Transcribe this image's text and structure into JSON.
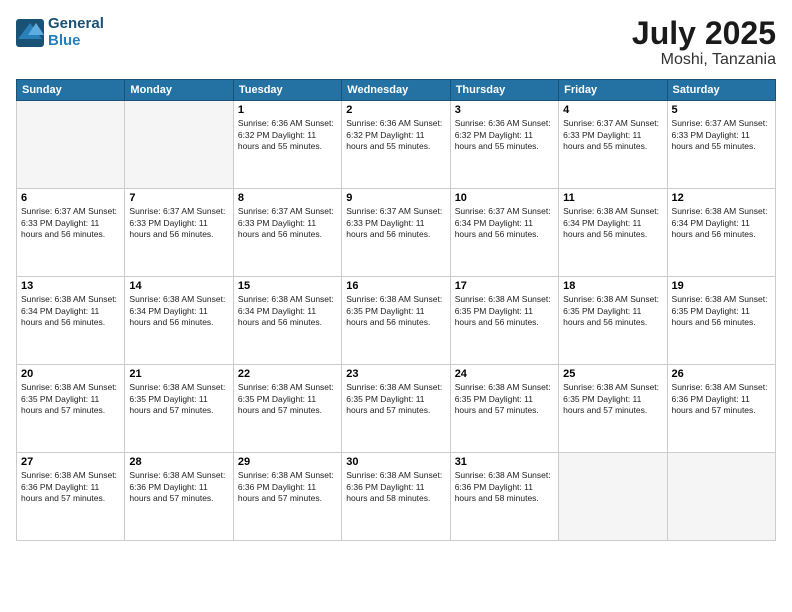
{
  "logo": {
    "line1": "General",
    "line2": "Blue"
  },
  "title": {
    "month_year": "July 2025",
    "location": "Moshi, Tanzania"
  },
  "days_of_week": [
    "Sunday",
    "Monday",
    "Tuesday",
    "Wednesday",
    "Thursday",
    "Friday",
    "Saturday"
  ],
  "weeks": [
    [
      {
        "day": "",
        "info": ""
      },
      {
        "day": "",
        "info": ""
      },
      {
        "day": "1",
        "info": "Sunrise: 6:36 AM\nSunset: 6:32 PM\nDaylight: 11 hours and 55 minutes."
      },
      {
        "day": "2",
        "info": "Sunrise: 6:36 AM\nSunset: 6:32 PM\nDaylight: 11 hours and 55 minutes."
      },
      {
        "day": "3",
        "info": "Sunrise: 6:36 AM\nSunset: 6:32 PM\nDaylight: 11 hours and 55 minutes."
      },
      {
        "day": "4",
        "info": "Sunrise: 6:37 AM\nSunset: 6:33 PM\nDaylight: 11 hours and 55 minutes."
      },
      {
        "day": "5",
        "info": "Sunrise: 6:37 AM\nSunset: 6:33 PM\nDaylight: 11 hours and 55 minutes."
      }
    ],
    [
      {
        "day": "6",
        "info": "Sunrise: 6:37 AM\nSunset: 6:33 PM\nDaylight: 11 hours and 56 minutes."
      },
      {
        "day": "7",
        "info": "Sunrise: 6:37 AM\nSunset: 6:33 PM\nDaylight: 11 hours and 56 minutes."
      },
      {
        "day": "8",
        "info": "Sunrise: 6:37 AM\nSunset: 6:33 PM\nDaylight: 11 hours and 56 minutes."
      },
      {
        "day": "9",
        "info": "Sunrise: 6:37 AM\nSunset: 6:33 PM\nDaylight: 11 hours and 56 minutes."
      },
      {
        "day": "10",
        "info": "Sunrise: 6:37 AM\nSunset: 6:34 PM\nDaylight: 11 hours and 56 minutes."
      },
      {
        "day": "11",
        "info": "Sunrise: 6:38 AM\nSunset: 6:34 PM\nDaylight: 11 hours and 56 minutes."
      },
      {
        "day": "12",
        "info": "Sunrise: 6:38 AM\nSunset: 6:34 PM\nDaylight: 11 hours and 56 minutes."
      }
    ],
    [
      {
        "day": "13",
        "info": "Sunrise: 6:38 AM\nSunset: 6:34 PM\nDaylight: 11 hours and 56 minutes."
      },
      {
        "day": "14",
        "info": "Sunrise: 6:38 AM\nSunset: 6:34 PM\nDaylight: 11 hours and 56 minutes."
      },
      {
        "day": "15",
        "info": "Sunrise: 6:38 AM\nSunset: 6:34 PM\nDaylight: 11 hours and 56 minutes."
      },
      {
        "day": "16",
        "info": "Sunrise: 6:38 AM\nSunset: 6:35 PM\nDaylight: 11 hours and 56 minutes."
      },
      {
        "day": "17",
        "info": "Sunrise: 6:38 AM\nSunset: 6:35 PM\nDaylight: 11 hours and 56 minutes."
      },
      {
        "day": "18",
        "info": "Sunrise: 6:38 AM\nSunset: 6:35 PM\nDaylight: 11 hours and 56 minutes."
      },
      {
        "day": "19",
        "info": "Sunrise: 6:38 AM\nSunset: 6:35 PM\nDaylight: 11 hours and 56 minutes."
      }
    ],
    [
      {
        "day": "20",
        "info": "Sunrise: 6:38 AM\nSunset: 6:35 PM\nDaylight: 11 hours and 57 minutes."
      },
      {
        "day": "21",
        "info": "Sunrise: 6:38 AM\nSunset: 6:35 PM\nDaylight: 11 hours and 57 minutes."
      },
      {
        "day": "22",
        "info": "Sunrise: 6:38 AM\nSunset: 6:35 PM\nDaylight: 11 hours and 57 minutes."
      },
      {
        "day": "23",
        "info": "Sunrise: 6:38 AM\nSunset: 6:35 PM\nDaylight: 11 hours and 57 minutes."
      },
      {
        "day": "24",
        "info": "Sunrise: 6:38 AM\nSunset: 6:35 PM\nDaylight: 11 hours and 57 minutes."
      },
      {
        "day": "25",
        "info": "Sunrise: 6:38 AM\nSunset: 6:35 PM\nDaylight: 11 hours and 57 minutes."
      },
      {
        "day": "26",
        "info": "Sunrise: 6:38 AM\nSunset: 6:36 PM\nDaylight: 11 hours and 57 minutes."
      }
    ],
    [
      {
        "day": "27",
        "info": "Sunrise: 6:38 AM\nSunset: 6:36 PM\nDaylight: 11 hours and 57 minutes."
      },
      {
        "day": "28",
        "info": "Sunrise: 6:38 AM\nSunset: 6:36 PM\nDaylight: 11 hours and 57 minutes."
      },
      {
        "day": "29",
        "info": "Sunrise: 6:38 AM\nSunset: 6:36 PM\nDaylight: 11 hours and 57 minutes."
      },
      {
        "day": "30",
        "info": "Sunrise: 6:38 AM\nSunset: 6:36 PM\nDaylight: 11 hours and 58 minutes."
      },
      {
        "day": "31",
        "info": "Sunrise: 6:38 AM\nSunset: 6:36 PM\nDaylight: 11 hours and 58 minutes."
      },
      {
        "day": "",
        "info": ""
      },
      {
        "day": "",
        "info": ""
      }
    ]
  ]
}
